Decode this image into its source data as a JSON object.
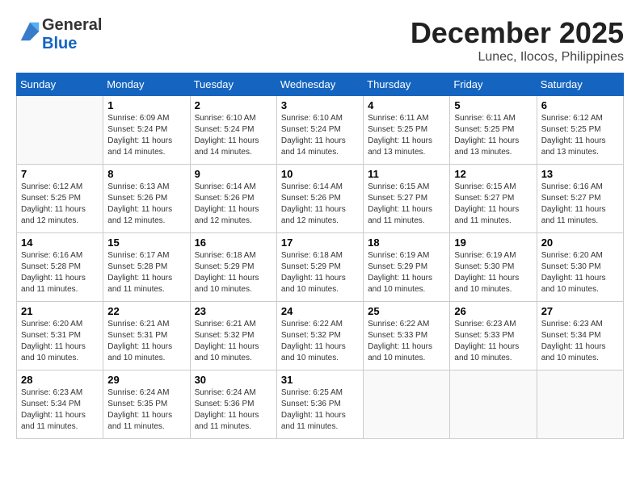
{
  "header": {
    "logo_line1": "General",
    "logo_line2": "Blue",
    "month": "December 2025",
    "location": "Lunec, Ilocos, Philippines"
  },
  "weekdays": [
    "Sunday",
    "Monday",
    "Tuesday",
    "Wednesday",
    "Thursday",
    "Friday",
    "Saturday"
  ],
  "weeks": [
    [
      {
        "day": "",
        "info": ""
      },
      {
        "day": "1",
        "info": "Sunrise: 6:09 AM\nSunset: 5:24 PM\nDaylight: 11 hours\nand 14 minutes."
      },
      {
        "day": "2",
        "info": "Sunrise: 6:10 AM\nSunset: 5:24 PM\nDaylight: 11 hours\nand 14 minutes."
      },
      {
        "day": "3",
        "info": "Sunrise: 6:10 AM\nSunset: 5:24 PM\nDaylight: 11 hours\nand 14 minutes."
      },
      {
        "day": "4",
        "info": "Sunrise: 6:11 AM\nSunset: 5:25 PM\nDaylight: 11 hours\nand 13 minutes."
      },
      {
        "day": "5",
        "info": "Sunrise: 6:11 AM\nSunset: 5:25 PM\nDaylight: 11 hours\nand 13 minutes."
      },
      {
        "day": "6",
        "info": "Sunrise: 6:12 AM\nSunset: 5:25 PM\nDaylight: 11 hours\nand 13 minutes."
      }
    ],
    [
      {
        "day": "7",
        "info": "Sunrise: 6:12 AM\nSunset: 5:25 PM\nDaylight: 11 hours\nand 12 minutes."
      },
      {
        "day": "8",
        "info": "Sunrise: 6:13 AM\nSunset: 5:26 PM\nDaylight: 11 hours\nand 12 minutes."
      },
      {
        "day": "9",
        "info": "Sunrise: 6:14 AM\nSunset: 5:26 PM\nDaylight: 11 hours\nand 12 minutes."
      },
      {
        "day": "10",
        "info": "Sunrise: 6:14 AM\nSunset: 5:26 PM\nDaylight: 11 hours\nand 12 minutes."
      },
      {
        "day": "11",
        "info": "Sunrise: 6:15 AM\nSunset: 5:27 PM\nDaylight: 11 hours\nand 11 minutes."
      },
      {
        "day": "12",
        "info": "Sunrise: 6:15 AM\nSunset: 5:27 PM\nDaylight: 11 hours\nand 11 minutes."
      },
      {
        "day": "13",
        "info": "Sunrise: 6:16 AM\nSunset: 5:27 PM\nDaylight: 11 hours\nand 11 minutes."
      }
    ],
    [
      {
        "day": "14",
        "info": "Sunrise: 6:16 AM\nSunset: 5:28 PM\nDaylight: 11 hours\nand 11 minutes."
      },
      {
        "day": "15",
        "info": "Sunrise: 6:17 AM\nSunset: 5:28 PM\nDaylight: 11 hours\nand 11 minutes."
      },
      {
        "day": "16",
        "info": "Sunrise: 6:18 AM\nSunset: 5:29 PM\nDaylight: 11 hours\nand 10 minutes."
      },
      {
        "day": "17",
        "info": "Sunrise: 6:18 AM\nSunset: 5:29 PM\nDaylight: 11 hours\nand 10 minutes."
      },
      {
        "day": "18",
        "info": "Sunrise: 6:19 AM\nSunset: 5:29 PM\nDaylight: 11 hours\nand 10 minutes."
      },
      {
        "day": "19",
        "info": "Sunrise: 6:19 AM\nSunset: 5:30 PM\nDaylight: 11 hours\nand 10 minutes."
      },
      {
        "day": "20",
        "info": "Sunrise: 6:20 AM\nSunset: 5:30 PM\nDaylight: 11 hours\nand 10 minutes."
      }
    ],
    [
      {
        "day": "21",
        "info": "Sunrise: 6:20 AM\nSunset: 5:31 PM\nDaylight: 11 hours\nand 10 minutes."
      },
      {
        "day": "22",
        "info": "Sunrise: 6:21 AM\nSunset: 5:31 PM\nDaylight: 11 hours\nand 10 minutes."
      },
      {
        "day": "23",
        "info": "Sunrise: 6:21 AM\nSunset: 5:32 PM\nDaylight: 11 hours\nand 10 minutes."
      },
      {
        "day": "24",
        "info": "Sunrise: 6:22 AM\nSunset: 5:32 PM\nDaylight: 11 hours\nand 10 minutes."
      },
      {
        "day": "25",
        "info": "Sunrise: 6:22 AM\nSunset: 5:33 PM\nDaylight: 11 hours\nand 10 minutes."
      },
      {
        "day": "26",
        "info": "Sunrise: 6:23 AM\nSunset: 5:33 PM\nDaylight: 11 hours\nand 10 minutes."
      },
      {
        "day": "27",
        "info": "Sunrise: 6:23 AM\nSunset: 5:34 PM\nDaylight: 11 hours\nand 10 minutes."
      }
    ],
    [
      {
        "day": "28",
        "info": "Sunrise: 6:23 AM\nSunset: 5:34 PM\nDaylight: 11 hours\nand 11 minutes."
      },
      {
        "day": "29",
        "info": "Sunrise: 6:24 AM\nSunset: 5:35 PM\nDaylight: 11 hours\nand 11 minutes."
      },
      {
        "day": "30",
        "info": "Sunrise: 6:24 AM\nSunset: 5:36 PM\nDaylight: 11 hours\nand 11 minutes."
      },
      {
        "day": "31",
        "info": "Sunrise: 6:25 AM\nSunset: 5:36 PM\nDaylight: 11 hours\nand 11 minutes."
      },
      {
        "day": "",
        "info": ""
      },
      {
        "day": "",
        "info": ""
      },
      {
        "day": "",
        "info": ""
      }
    ]
  ]
}
